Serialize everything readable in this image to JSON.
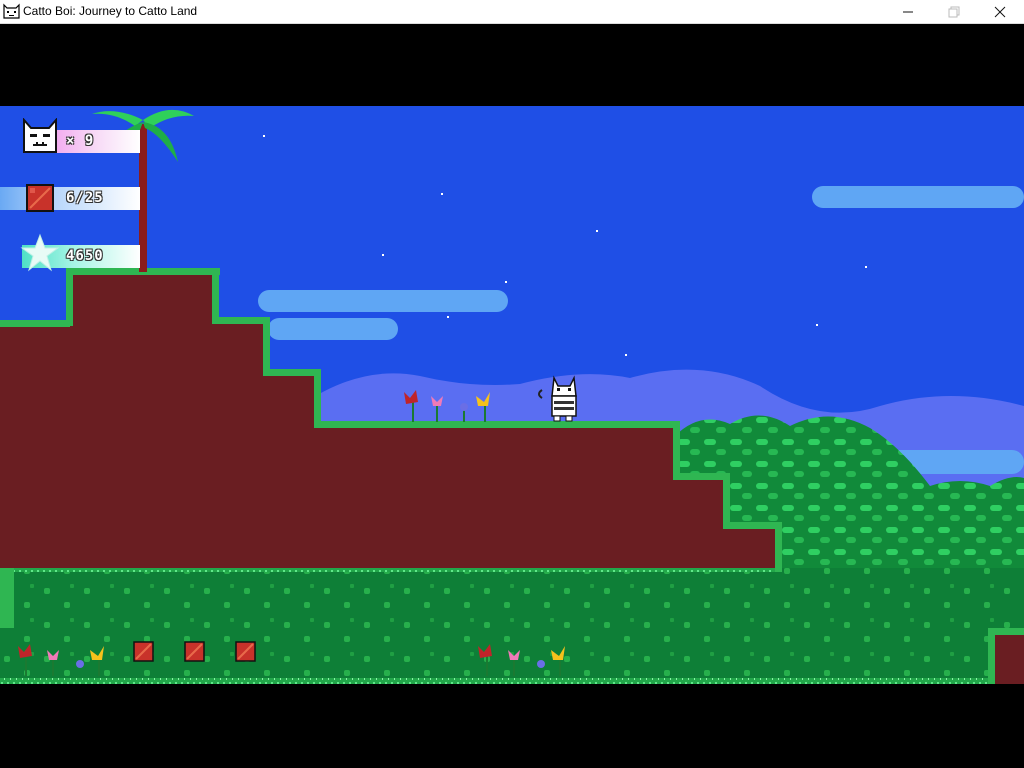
{
  "window": {
    "title": "Catto Boi: Journey to Catto Land",
    "icon": "cat-face-icon",
    "controls": [
      "minimize-icon",
      "maximize-icon",
      "close-icon"
    ]
  },
  "hud": {
    "lives": {
      "icon": "cat-face-icon",
      "text": "× 9"
    },
    "boxes": {
      "icon": "crate-icon",
      "text": "6/25"
    },
    "score": {
      "icon": "star-icon",
      "text": "4650"
    }
  },
  "colors": {
    "sky": "#1f4fe6",
    "dirt": "#6a1e22",
    "grass": "#1fa84a",
    "grass_dark": "#0c7a33",
    "cloud": "#5fa6f4",
    "hills": "#5a6ef2"
  }
}
